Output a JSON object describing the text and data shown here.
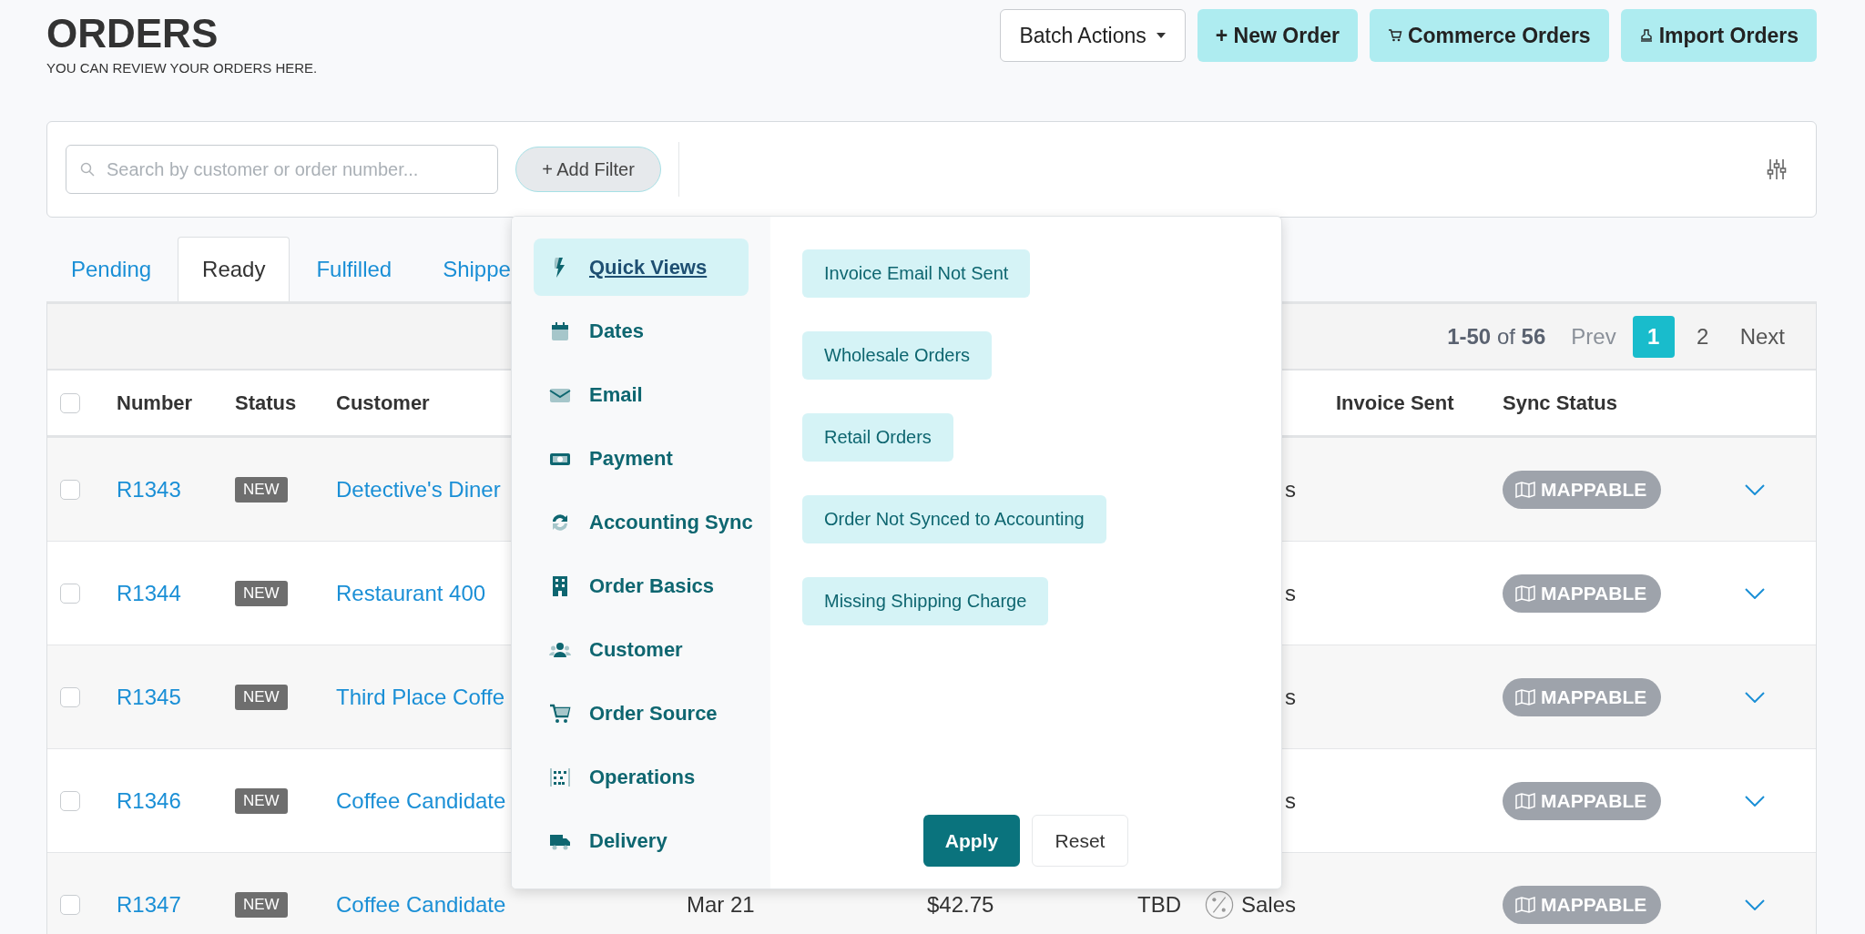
{
  "header": {
    "title": "ORDERS",
    "subtitle": "YOU CAN REVIEW YOUR ORDERS HERE."
  },
  "actions": [
    {
      "kind": "dropdown",
      "label": "Batch Actions"
    },
    {
      "kind": "new",
      "label": "+ New Order"
    },
    {
      "kind": "cart",
      "label": "Commerce Orders"
    },
    {
      "kind": "import",
      "label": "Import Orders"
    }
  ],
  "filter_bar": {
    "search": {
      "placeholder": "Search by customer or order number..."
    },
    "add_filter": "+ Add Filter"
  },
  "tabs": [
    {
      "label": "Pending",
      "selected": false
    },
    {
      "label": "Ready",
      "selected": true
    },
    {
      "label": "Fulfilled",
      "selected": false
    },
    {
      "label": "Shippe",
      "selected": false
    }
  ],
  "pagination": {
    "summary": "**1-50** of **56**",
    "prev": "Prev",
    "pages": [
      {
        "label": "1",
        "selected": true
      },
      {
        "label": "2",
        "selected": false
      }
    ],
    "next": "Next"
  },
  "table": {
    "select_all_checked": false,
    "columns": [
      "Number",
      "Status",
      "Customer",
      "Invoice Sent",
      "Sync Status"
    ],
    "rows": [
      {
        "checked": false,
        "number": "R1343",
        "status": "NEW",
        "customer": "Detective's Diner",
        "column_8": "s",
        "sync_status": "MAPPABLE"
      },
      {
        "checked": false,
        "number": "R1344",
        "status": "NEW",
        "customer": "Restaurant 400",
        "column_8": "s",
        "sync_status": "MAPPABLE"
      },
      {
        "checked": false,
        "number": "R1345",
        "status": "NEW",
        "customer": "Third Place Coffe",
        "column_8": "s",
        "sync_status": "MAPPABLE"
      },
      {
        "checked": false,
        "number": "R1346",
        "status": "NEW",
        "customer": "Coffee Candidate",
        "column_8": "s",
        "sync_status": "MAPPABLE"
      },
      {
        "checked": false,
        "number": "R1347",
        "status": "NEW",
        "customer": "Coffee Candidate",
        "column_5": "Mar 21",
        "column_6": "$42.75",
        "column_7": "TBD",
        "column_8": "Sales",
        "sync_status": "MAPPABLE"
      }
    ]
  },
  "filter_menu": {
    "categories": [
      {
        "label": "Quick Views",
        "selected": true
      },
      {
        "label": "Dates",
        "selected": false
      },
      {
        "label": "Email",
        "selected": false
      },
      {
        "label": "Payment",
        "selected": false
      },
      {
        "label": "Accounting Sync",
        "selected": false
      },
      {
        "label": "Order Basics",
        "selected": false
      },
      {
        "label": "Customer",
        "selected": false
      },
      {
        "label": "Order Source",
        "selected": false
      },
      {
        "label": "Operations",
        "selected": false
      },
      {
        "label": "Delivery",
        "selected": false
      }
    ],
    "quick_views": [
      "Invoice Email Not Sent",
      "Wholesale Orders",
      "Retail Orders",
      "Order Not Synced to Accounting",
      "Missing Shipping Charge"
    ],
    "apply": "Apply",
    "reset": "Reset"
  }
}
